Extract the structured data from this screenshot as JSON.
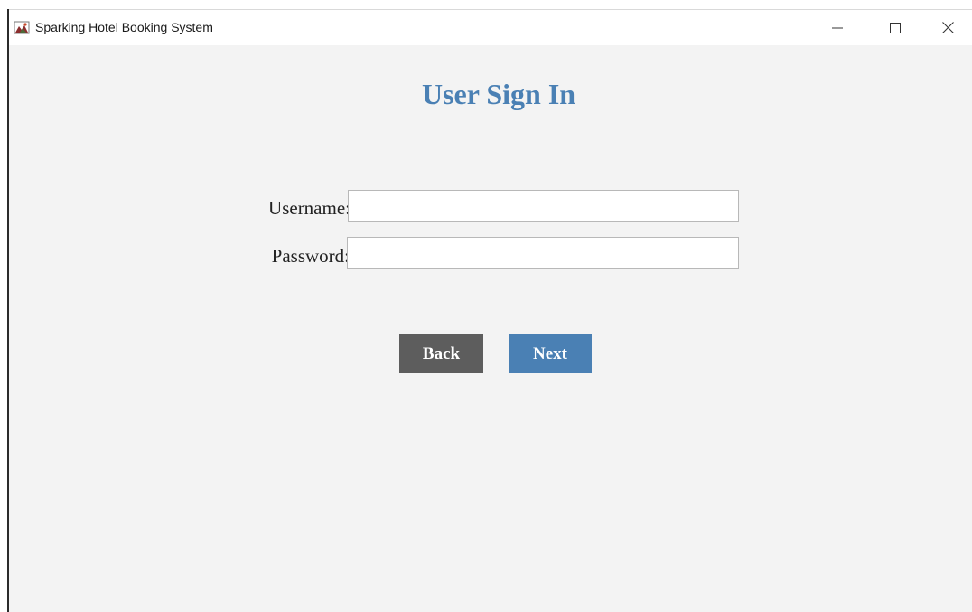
{
  "window": {
    "title": "Sparking Hotel Booking System",
    "icon": "java-app-icon",
    "controls": [
      "minimize-icon",
      "maximize-icon",
      "close-icon"
    ]
  },
  "form": {
    "heading": "User Sign In",
    "username_label": "Username:",
    "username_value": "",
    "password_label": "Password:",
    "password_value": ""
  },
  "buttons": {
    "back_label": "Back",
    "next_label": "Next"
  },
  "colors": {
    "accent": "#4a80b4",
    "back_button": "#5d5d5d",
    "background": "#f3f3f3"
  }
}
